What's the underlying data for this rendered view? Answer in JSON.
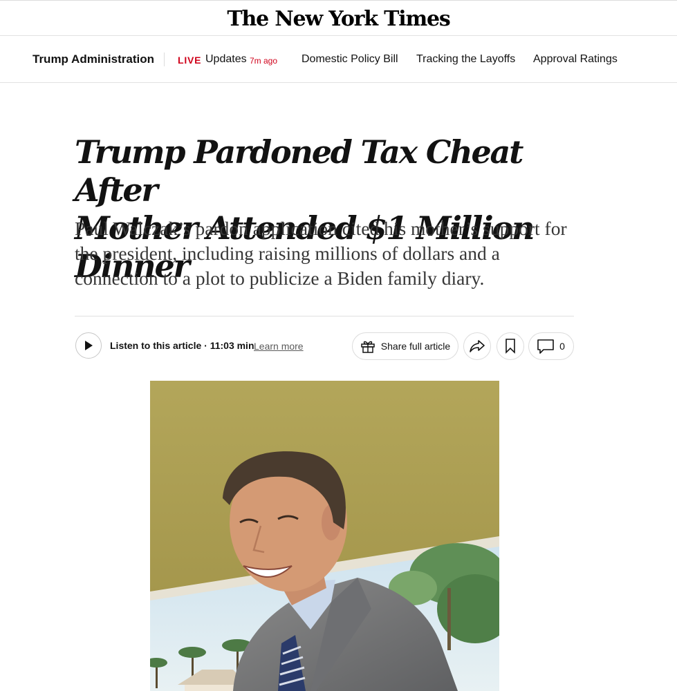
{
  "masthead": {
    "logo_text": "The New York Times"
  },
  "nav": {
    "section": "Trump Administration",
    "live_label": "LIVE",
    "updates_label": "Updates",
    "updates_time": "7m ago",
    "links": [
      "Domestic Policy Bill",
      "Tracking the Layoffs",
      "Approval Ratings"
    ]
  },
  "article": {
    "headline_line1": "Trump Pardoned Tax Cheat After",
    "headline_line2": "Mother Attended $1 Million Dinner",
    "summary": "Paul Walczak’s pardon application cited his mother’s support for the president, including raising millions of dollars and a connection to a plot to publicize a Biden family diary."
  },
  "toolbar": {
    "listen_label": "Listen to this article · 11:03 min",
    "learn_more": "Learn more",
    "share_label": "Share full article",
    "comment_count": "0"
  },
  "icons": {
    "play": "play-icon",
    "gift": "gift-icon",
    "forward": "share-arrow-icon",
    "bookmark": "bookmark-icon",
    "comment": "comment-icon"
  },
  "colors": {
    "live_red": "#d0021b",
    "text": "#121212",
    "photo_wall": "#a99c52"
  }
}
